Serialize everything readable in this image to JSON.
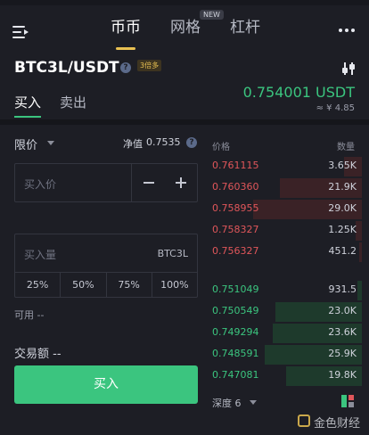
{
  "nav": {
    "tabs": [
      {
        "label": "币币"
      },
      {
        "label": "网格",
        "badge": "NEW"
      },
      {
        "label": "杠杆"
      }
    ]
  },
  "pair": {
    "symbol": "BTC3L/USDT",
    "leverage_badge": "3倍多",
    "side_tabs": {
      "buy": "买入",
      "sell": "卖出"
    },
    "last_price": "0.754001 USDT",
    "fiat_price": "≈ ¥ 4.85"
  },
  "form": {
    "order_type": "限价",
    "nav_label": "净值",
    "nav_value": "0.7535",
    "price_placeholder": "买入价",
    "qty_placeholder": "买入量",
    "qty_unit": "BTC3L",
    "percents": [
      "25%",
      "50%",
      "75%",
      "100%"
    ],
    "available": "可用 --",
    "amount": "交易额 --",
    "buy_button": "买入"
  },
  "orderbook": {
    "price_header": "价格",
    "qty_header": "数量",
    "asks": [
      {
        "price": "0.761115",
        "qty": "3.65K",
        "fill": 0.12
      },
      {
        "price": "0.760360",
        "qty": "21.9K",
        "fill": 0.54
      },
      {
        "price": "0.758955",
        "qty": "29.0K",
        "fill": 0.72
      },
      {
        "price": "0.758327",
        "qty": "1.25K",
        "fill": 0.04
      },
      {
        "price": "0.756327",
        "qty": "451.2",
        "fill": 0.02
      }
    ],
    "bids": [
      {
        "price": "0.751049",
        "qty": "931.5",
        "fill": 0.03
      },
      {
        "price": "0.750549",
        "qty": "23.0K",
        "fill": 0.57
      },
      {
        "price": "0.749294",
        "qty": "23.6K",
        "fill": 0.59
      },
      {
        "price": "0.748591",
        "qty": "25.9K",
        "fill": 0.64
      },
      {
        "price": "0.747081",
        "qty": "19.8K",
        "fill": 0.5
      }
    ],
    "depth_label": "深度 6"
  },
  "watermark": "金色财经",
  "colors": {
    "buy": "#3bc57f",
    "sell": "#e0565a",
    "accent": "#e9c152",
    "background": "#1d1e25"
  }
}
